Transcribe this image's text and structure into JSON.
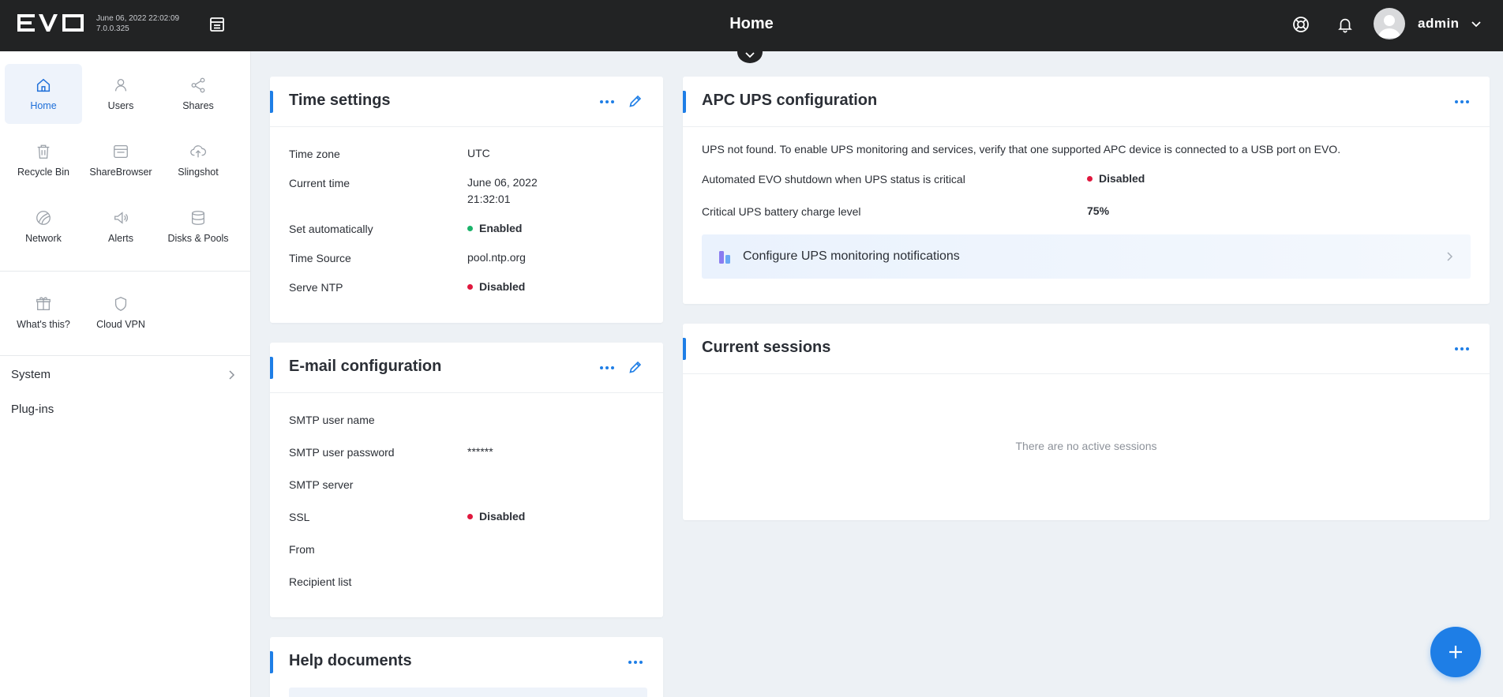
{
  "app": {
    "logo_text": "EVO",
    "build_date": "June 06, 2022 22:02:09",
    "build_version": "7.0.0.325",
    "page_title": "Home",
    "username": "admin",
    "accent_color": "#1e7ee6"
  },
  "header_icons": [
    "layout-icon",
    "support-icon",
    "bell-icon",
    "chevron-down-icon"
  ],
  "sidebar": {
    "items": [
      {
        "label": "Home",
        "icon": "home-icon",
        "active": true
      },
      {
        "label": "Users",
        "icon": "user-icon"
      },
      {
        "label": "Shares",
        "icon": "share-icon"
      },
      {
        "label": "Recycle Bin",
        "icon": "trash-icon"
      },
      {
        "label": "ShareBrowser",
        "icon": "browser-icon"
      },
      {
        "label": "Slingshot",
        "icon": "cloud-upload-icon"
      },
      {
        "label": "Network",
        "icon": "network-icon"
      },
      {
        "label": "Alerts",
        "icon": "megaphone-icon"
      },
      {
        "label": "Disks & Pools",
        "icon": "database-icon"
      },
      {
        "label": "What's this?",
        "icon": "gift-icon"
      },
      {
        "label": "Cloud VPN",
        "icon": "shield-icon"
      }
    ],
    "system_label": "System",
    "plugins_label": "Plug-ins"
  },
  "time_settings": {
    "title": "Time settings",
    "rows": [
      {
        "label": "Time zone",
        "value": "UTC"
      },
      {
        "label": "Current time",
        "value_line1": "June 06, 2022",
        "value_line2": "21:32:01"
      },
      {
        "label": "Set automatically",
        "value": "Enabled",
        "status": "green"
      },
      {
        "label": "Time Source",
        "value": "pool.ntp.org"
      },
      {
        "label": "Serve NTP",
        "value": "Disabled",
        "status": "red"
      }
    ]
  },
  "email_config": {
    "title": "E-mail configuration",
    "rows": [
      {
        "label": "SMTP user name",
        "value": ""
      },
      {
        "label": "SMTP user password",
        "value": "******"
      },
      {
        "label": "SMTP server",
        "value": ""
      },
      {
        "label": "SSL",
        "value": "Disabled",
        "status": "red"
      },
      {
        "label": "From",
        "value": ""
      },
      {
        "label": "Recipient list",
        "value": ""
      }
    ]
  },
  "help_documents": {
    "title": "Help documents"
  },
  "ups_config": {
    "title": "APC UPS configuration",
    "message": "UPS not found. To enable UPS monitoring and services, verify that one supported APC device is connected to a USB port on EVO.",
    "rows": [
      {
        "label": "Automated EVO shutdown when UPS status is critical",
        "value": "Disabled",
        "status": "red"
      },
      {
        "label": "Critical UPS battery charge level",
        "value": "75%"
      }
    ],
    "notifications_link": "Configure UPS monitoring notifications"
  },
  "sessions": {
    "title": "Current sessions",
    "empty_text": "There are no active sessions"
  },
  "colors": {
    "topbar": "#222324",
    "status_green": "#1bb36a",
    "status_red": "#e0183e",
    "background": "#edf1f5"
  }
}
